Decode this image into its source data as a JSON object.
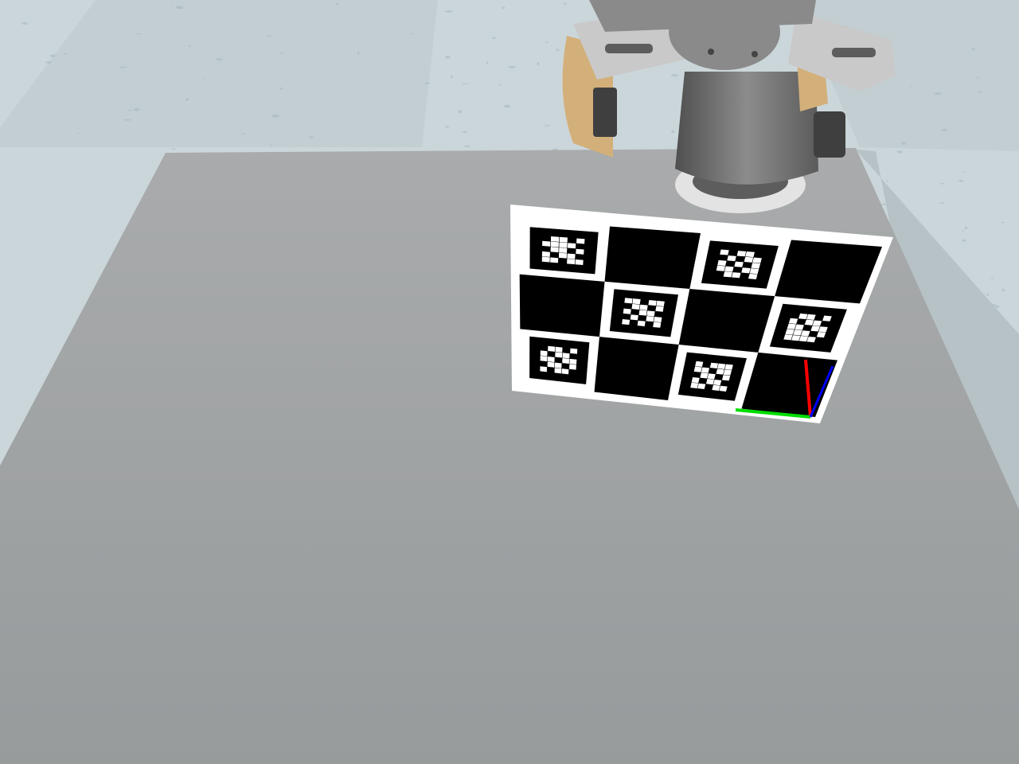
{
  "scene": {
    "colors": {
      "floor": "#cbd6da",
      "floor_tile_alt": "#c3ced2",
      "floor_speckle": "#9fb3ba",
      "table_top": "#9fa2a3",
      "table_edge": "#b6c2c6",
      "board_white": "#ffffff",
      "board_black": "#000000",
      "robot_dark": "#5d5d5d",
      "robot_mid": "#8a8a8a",
      "robot_light": "#c9c9c9",
      "robot_tan": "#d3b07a",
      "axis_x": "#ff0000",
      "axis_y": "#00dd00",
      "axis_z": "#0000ff"
    },
    "board": {
      "rows": 3,
      "cols": 4,
      "cells": [
        [
          "marker",
          "black",
          "marker",
          "black"
        ],
        [
          "black",
          "marker",
          "black",
          "marker"
        ],
        [
          "marker",
          "black",
          "marker",
          "black"
        ]
      ]
    },
    "icons": {
      "gripper": "robot-gripper-icon",
      "axes": "pose-axes-icon"
    }
  }
}
